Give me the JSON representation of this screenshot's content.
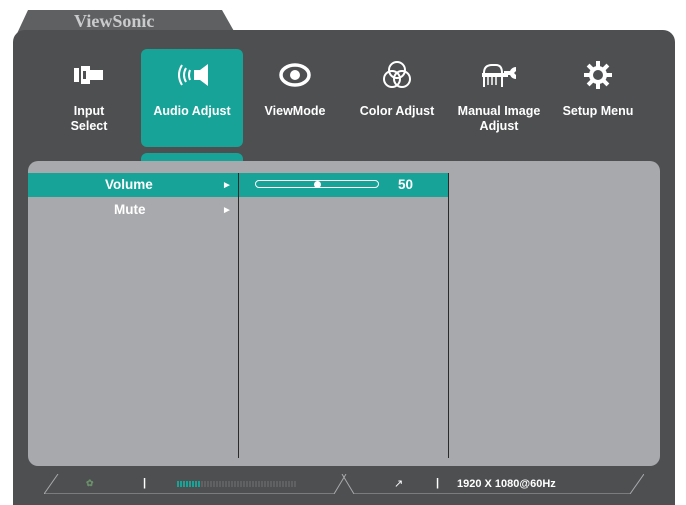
{
  "brand": {
    "name": "ViewSonic"
  },
  "colors": {
    "accent": "#17a398",
    "osd_background": "#4d4f51",
    "panel": "#a7a9ac",
    "brand_tab": "#5e6062",
    "text": "#ffffff"
  },
  "menu": {
    "items": [
      {
        "label": "Input\nSelect",
        "icon": "input-select-icon"
      },
      {
        "label": "Audio Adjust",
        "icon": "speaker-icon",
        "selected": true
      },
      {
        "label": "ViewMode",
        "icon": "eye-icon"
      },
      {
        "label": "Color Adjust",
        "icon": "color-circles-icon"
      },
      {
        "label": "Manual Image\nAdjust",
        "icon": "hand-wrench-icon"
      },
      {
        "label": "Setup Menu",
        "icon": "gear-icon"
      }
    ]
  },
  "submenu": {
    "items": [
      {
        "label": "Volume",
        "selected": true,
        "arrow": "►"
      },
      {
        "label": "Mute",
        "selected": false,
        "arrow": "►"
      }
    ]
  },
  "volume": {
    "value": "50",
    "level": 0.5
  },
  "status": {
    "separator": "|",
    "resolution": "1920 X 1080@60Hz",
    "volume_bar_level": 0.2,
    "icons": [
      "eco-icon",
      "external-link-icon"
    ]
  }
}
